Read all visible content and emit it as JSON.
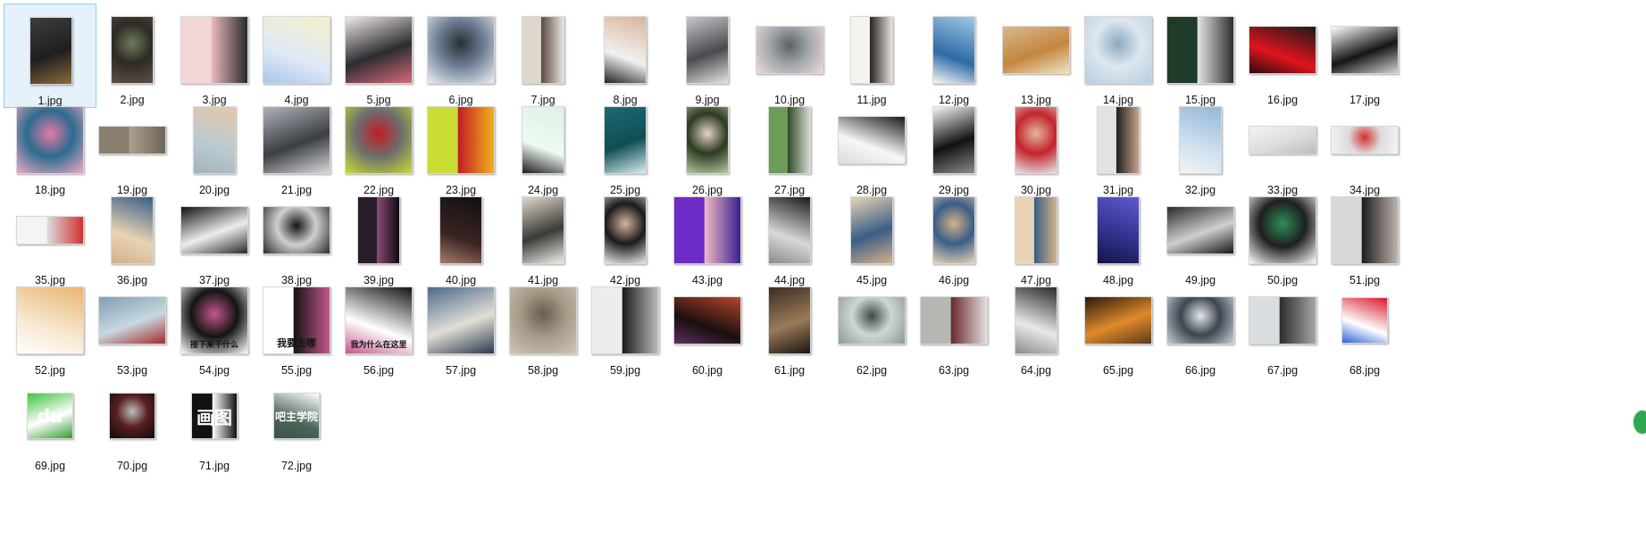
{
  "files": [
    {
      "label": "1.jpg",
      "shape": "tall",
      "colors": [
        "#3d3d3d",
        "#1f1f1f",
        "#8a6a3b"
      ],
      "selected": true
    },
    {
      "label": "2.jpg",
      "shape": "tall",
      "colors": [
        "#5f5048",
        "#2e2a26",
        "#6d7a5a"
      ]
    },
    {
      "label": "3.jpg",
      "shape": "square",
      "colors": [
        "#f3d6d6",
        "#e8b8bf",
        "#2a2a2a"
      ]
    },
    {
      "label": "4.jpg",
      "shape": "square",
      "colors": [
        "#dfe9f7",
        "#f4f0c9",
        "#a8c6e8"
      ]
    },
    {
      "label": "5.jpg",
      "shape": "square",
      "colors": [
        "#f2e8ea",
        "#2c2c30",
        "#d86a7a"
      ]
    },
    {
      "label": "6.jpg",
      "shape": "square",
      "colors": [
        "#eef0f3",
        "#6d7f95",
        "#2b2f36"
      ]
    },
    {
      "label": "7.jpg",
      "shape": "tall",
      "colors": [
        "#ded7cc",
        "#5a4a42",
        "#e8e6e0"
      ]
    },
    {
      "label": "8.jpg",
      "shape": "tall",
      "colors": [
        "#f1f1f1",
        "#d9b49a",
        "#232323"
      ]
    },
    {
      "label": "9.jpg",
      "shape": "tall",
      "colors": [
        "#c6c6cc",
        "#4b4a50",
        "#e6e1dc"
      ]
    },
    {
      "label": "10.jpg",
      "shape": "wide",
      "colors": [
        "#f2d7df",
        "#9fa6ab",
        "#5f5f63"
      ]
    },
    {
      "label": "11.jpg",
      "shape": "tall",
      "colors": [
        "#f6f2ee",
        "#2a2422",
        "#e9e2db"
      ]
    },
    {
      "label": "12.jpg",
      "shape": "tall",
      "colors": [
        "#2d6aa6",
        "#9ec7e5",
        "#f6f6f6"
      ]
    },
    {
      "label": "13.jpg",
      "shape": "wide",
      "colors": [
        "#d8b88b",
        "#c4863f",
        "#efe3c5"
      ]
    },
    {
      "label": "14.jpg",
      "shape": "square",
      "colors": [
        "#b7cde0",
        "#dce7f0",
        "#8ea9bf"
      ]
    },
    {
      "label": "15.jpg",
      "shape": "square",
      "colors": [
        "#1f3b2a",
        "#e4e4e4",
        "#2e2e2e"
      ]
    },
    {
      "label": "16.jpg",
      "shape": "wide",
      "colors": [
        "#e0141e",
        "#1a1a1a",
        "#2a0b0c"
      ]
    },
    {
      "label": "17.jpg",
      "shape": "wide",
      "colors": [
        "#ffffff",
        "#151515",
        "#d4d4d4"
      ]
    },
    {
      "label": "18.jpg",
      "shape": "square",
      "colors": [
        "#f1a9c5",
        "#2b6c8f",
        "#e57aa6"
      ]
    },
    {
      "label": "19.jpg",
      "shape": "strip",
      "colors": [
        "#8a806f",
        "#a99f8d",
        "#6d6558"
      ]
    },
    {
      "label": "20.jpg",
      "shape": "tall",
      "colors": [
        "#b8cad1",
        "#e7c7a7",
        "#a3b2b9"
      ]
    },
    {
      "label": "21.jpg",
      "shape": "square",
      "colors": [
        "#aeb3b9",
        "#3b3e43",
        "#d7d9dc"
      ]
    },
    {
      "label": "22.jpg",
      "shape": "square",
      "colors": [
        "#c9dd35",
        "#6d6d6d",
        "#c21d25"
      ]
    },
    {
      "label": "23.jpg",
      "shape": "square",
      "colors": [
        "#c9dd35",
        "#c21d25",
        "#f1b21c"
      ]
    },
    {
      "label": "24.jpg",
      "shape": "tall",
      "colors": [
        "#eef9f1",
        "#dff2e6",
        "#1d1d1d"
      ]
    },
    {
      "label": "25.jpg",
      "shape": "tall",
      "colors": [
        "#1d6a72",
        "#0f4d55",
        "#d8ecee"
      ]
    },
    {
      "label": "26.jpg",
      "shape": "tall",
      "colors": [
        "#b7c7a0",
        "#2c3a21",
        "#e3d3c6"
      ]
    },
    {
      "label": "27.jpg",
      "shape": "tall",
      "colors": [
        "#6d9b58",
        "#2f4a26",
        "#d7dbd2"
      ]
    },
    {
      "label": "28.jpg",
      "shape": "wide",
      "colors": [
        "#f7f7f7",
        "#1a1a1a",
        "#d7dce2"
      ]
    },
    {
      "label": "29.jpg",
      "shape": "tall",
      "colors": [
        "#f6f6f6",
        "#111111",
        "#8a8a8a"
      ]
    },
    {
      "label": "30.jpg",
      "shape": "tall",
      "colors": [
        "#e6e7ea",
        "#c3242b",
        "#e4b69c"
      ]
    },
    {
      "label": "31.jpg",
      "shape": "tall",
      "colors": [
        "#e3e3e3",
        "#1f1f1f",
        "#c7a28a"
      ]
    },
    {
      "label": "32.jpg",
      "shape": "tall",
      "colors": [
        "#cfe1f0",
        "#94b7d7",
        "#f3f3f3"
      ]
    },
    {
      "label": "33.jpg",
      "shape": "strip",
      "colors": [
        "#f4f4f4",
        "#dcdcdc",
        "#bcbcbc"
      ]
    },
    {
      "label": "34.jpg",
      "shape": "strip",
      "colors": [
        "#f4f4f4",
        "#dcdcdc",
        "#d43030"
      ]
    },
    {
      "label": "35.jpg",
      "shape": "strip",
      "colors": [
        "#f4f4f4",
        "#dcdcdc",
        "#d43030"
      ]
    },
    {
      "label": "36.jpg",
      "shape": "tall",
      "colors": [
        "#e8d3b5",
        "#3a5e86",
        "#d3b08b"
      ]
    },
    {
      "label": "37.jpg",
      "shape": "wide",
      "colors": [
        "#111111",
        "#ededed",
        "#2a2a2a"
      ]
    },
    {
      "label": "38.jpg",
      "shape": "wide",
      "colors": [
        "#2b2b2b",
        "#cfcfcf",
        "#151515"
      ]
    },
    {
      "label": "39.jpg",
      "shape": "tall",
      "colors": [
        "#2a1d2b",
        "#8e4b78",
        "#0f0a12"
      ]
    },
    {
      "label": "40.jpg",
      "shape": "tall",
      "colors": [
        "#3a2323",
        "#121010",
        "#a57b69"
      ]
    },
    {
      "label": "41.jpg",
      "shape": "tall",
      "colors": [
        "#dfd6cc",
        "#3b3a36",
        "#f1efe9"
      ]
    },
    {
      "label": "42.jpg",
      "shape": "tall",
      "colors": [
        "#e4ebf0",
        "#1a1a1a",
        "#d7b49b"
      ]
    },
    {
      "label": "43.jpg",
      "shape": "square",
      "colors": [
        "#6d2cc6",
        "#f0b9c6",
        "#3a1f8f"
      ]
    },
    {
      "label": "44.jpg",
      "shape": "tall",
      "colors": [
        "#d8d8d8",
        "#1a1a1a",
        "#8a8a8a"
      ]
    },
    {
      "label": "45.jpg",
      "shape": "tall",
      "colors": [
        "#e8d3b5",
        "#3a5e86",
        "#d3b08b"
      ]
    },
    {
      "label": "46.jpg",
      "shape": "tall",
      "colors": [
        "#e8d3b5",
        "#3a5e86",
        "#d3b08b"
      ]
    },
    {
      "label": "47.jpg",
      "shape": "tall",
      "colors": [
        "#e8d3b5",
        "#3a5e86",
        "#d3b08b"
      ]
    },
    {
      "label": "48.jpg",
      "shape": "tall",
      "colors": [
        "#2f2f86",
        "#5c5ad0",
        "#151547"
      ]
    },
    {
      "label": "49.jpg",
      "shape": "wide",
      "colors": [
        "#2b2b2b",
        "#cfcfcf",
        "#151515"
      ]
    },
    {
      "label": "50.jpg",
      "shape": "square",
      "colors": [
        "#ffffff",
        "#1f1f1f",
        "#2f8c58"
      ]
    },
    {
      "label": "51.jpg",
      "shape": "square",
      "colors": [
        "#d8d8d8",
        "#1c1c1c",
        "#bfb3ac"
      ]
    },
    {
      "label": "52.jpg",
      "shape": "square",
      "colors": [
        "#f7e9d3",
        "#e8b56f",
        "#ffffff"
      ]
    },
    {
      "label": "53.jpg",
      "shape": "wide",
      "colors": [
        "#7f9fb2",
        "#c8d7df",
        "#a62a2a"
      ]
    },
    {
      "label": "54.jpg",
      "shape": "square",
      "colors": [
        "#ffffff",
        "#141414",
        "#c4578c"
      ],
      "caption": "接下来干什么"
    },
    {
      "label": "55.jpg",
      "shape": "square",
      "colors": [
        "#ffffff",
        "#141414",
        "#c4578c"
      ],
      "caption": "我要去哪"
    },
    {
      "label": "56.jpg",
      "shape": "square",
      "colors": [
        "#ffffff",
        "#141414",
        "#c4578c"
      ],
      "caption": "我为什么在这里"
    },
    {
      "label": "57.jpg",
      "shape": "square",
      "colors": [
        "#4e6a8c",
        "#e1ded6",
        "#2a3a4c"
      ]
    },
    {
      "label": "58.jpg",
      "shape": "square",
      "colors": [
        "#cdc5b8",
        "#a79a89",
        "#6a5d4e"
      ]
    },
    {
      "label": "59.jpg",
      "shape": "square",
      "colors": [
        "#ececec",
        "#1a1a1a",
        "#bdbdbd"
      ]
    },
    {
      "label": "60.jpg",
      "shape": "wide",
      "colors": [
        "#1a0f0f",
        "#b4462a",
        "#5b2f5e"
      ]
    },
    {
      "label": "61.jpg",
      "shape": "tall",
      "colors": [
        "#3a2e22",
        "#9a7a58",
        "#1a1510"
      ]
    },
    {
      "label": "62.jpg",
      "shape": "wide",
      "colors": [
        "#8a9a9a",
        "#cfd6d3",
        "#3d4a45"
      ]
    },
    {
      "label": "63.jpg",
      "shape": "wide",
      "colors": [
        "#b8b6b2",
        "#6a2a30",
        "#e2e0dc"
      ]
    },
    {
      "label": "64.jpg",
      "shape": "tall",
      "colors": [
        "#e8e8e8",
        "#2a2a2a",
        "#8c8c8c"
      ]
    },
    {
      "label": "65.jpg",
      "shape": "wide",
      "colors": [
        "#2a1a0f",
        "#e08a2a",
        "#5a3a1a"
      ]
    },
    {
      "label": "66.jpg",
      "shape": "wide",
      "colors": [
        "#c9cfd6",
        "#3b4650",
        "#e7e7e7"
      ]
    },
    {
      "label": "67.jpg",
      "shape": "wide",
      "colors": [
        "#d9dfe0",
        "#2d2d2d",
        "#a3a7a2"
      ]
    },
    {
      "label": "68.jpg",
      "shape": "small",
      "colors": [
        "#ffffff",
        "#d8192a",
        "#2f64d8"
      ]
    },
    {
      "label": "69.jpg",
      "shape": "small",
      "colors": [
        "#3fc33f",
        "#ffffff",
        "#2f9d2f"
      ],
      "caption": "du"
    },
    {
      "label": "70.jpg",
      "shape": "small",
      "colors": [
        "#0b0b0b",
        "#5a1f1f",
        "#bdbdbd"
      ]
    },
    {
      "label": "71.jpg",
      "shape": "small",
      "colors": [
        "#111111",
        "#ffffff",
        "#111111"
      ],
      "caption": "画图"
    },
    {
      "label": "72.jpg",
      "shape": "small",
      "colors": [
        "#4a6458",
        "#ffffff",
        "#3a5447"
      ],
      "caption": "吧主学院"
    }
  ]
}
